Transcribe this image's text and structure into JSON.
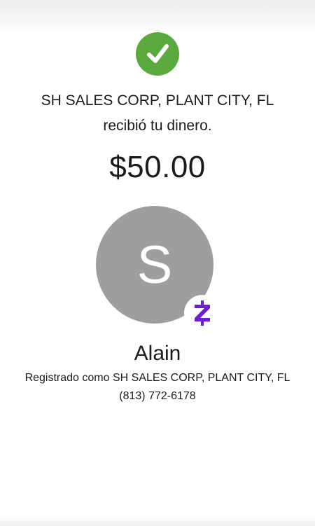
{
  "confirmation": {
    "recipient_name": "SH SALES CORP, PLANT CITY, FL",
    "status_text": "recibió tu dinero.",
    "amount": "$50.00",
    "check_icon": "check-circle-icon",
    "check_color": "#5aa93c"
  },
  "contact": {
    "avatar_initial": "S",
    "avatar_color": "#9e9e9e",
    "badge_icon": "zelle-logo-icon",
    "badge_color": "#6d1ed4",
    "name": "Alain",
    "registered_as": "Registrado como SH SALES CORP, PLANT CITY, FL",
    "phone": "(813) 772-6178"
  }
}
